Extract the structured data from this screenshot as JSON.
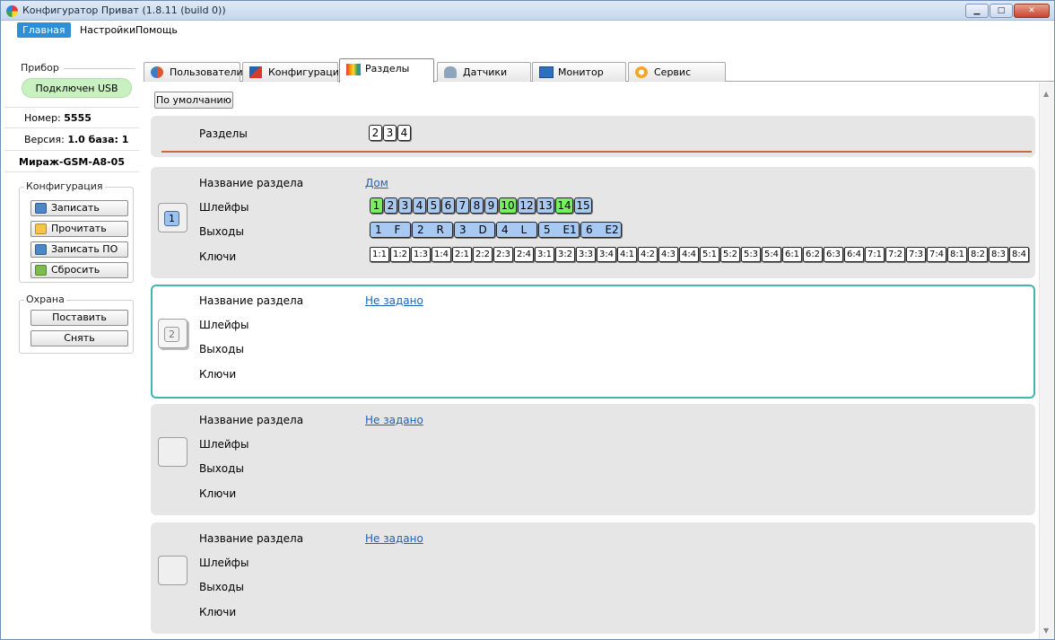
{
  "window": {
    "title": "Конфигуратор Приват (1.8.11 (build 0))"
  },
  "menu": {
    "items": [
      "Главная",
      "Настройки",
      "Помощь"
    ]
  },
  "device": {
    "legend": "Прибор",
    "status": "Подключен USB",
    "number_label": "Номер:",
    "number_value": "5555",
    "version_label": "Версия:",
    "version_value": "1.0 база: 1",
    "model": "Мираж-GSM-A8-05"
  },
  "config": {
    "legend": "Конфигурация",
    "write": "Записать",
    "read": "Прочитать",
    "write_fw": "Записать ПО",
    "reset": "Сбросить"
  },
  "guard": {
    "legend": "Охрана",
    "arm": "Поставить",
    "disarm": "Снять"
  },
  "tabs": [
    {
      "label": "Пользователи",
      "icon": "users-icon"
    },
    {
      "label": "Конфигурация",
      "icon": "tools-icon"
    },
    {
      "label": "Разделы",
      "icon": "sections-icon"
    },
    {
      "label": "Датчики",
      "icon": "sensors-icon"
    },
    {
      "label": "Монитор",
      "icon": "monitor-icon"
    },
    {
      "label": "Сервис",
      "icon": "service-icon"
    }
  ],
  "active_tab": "Разделы",
  "content": {
    "default_button": "По умолчанию",
    "sections_label": "Разделы",
    "sections_chips": [
      "2",
      "3",
      "4"
    ]
  },
  "labels": {
    "name": "Название раздела",
    "loops": "Шлейфы",
    "outputs": "Выходы",
    "keys": "Ключи"
  },
  "sections": [
    {
      "number": "1",
      "name": "Дом",
      "loops": [
        {
          "n": "1",
          "state": "green"
        },
        {
          "n": "2",
          "state": "blue"
        },
        {
          "n": "3",
          "state": "blue"
        },
        {
          "n": "4",
          "state": "blue"
        },
        {
          "n": "5",
          "state": "blue"
        },
        {
          "n": "6",
          "state": "blue"
        },
        {
          "n": "7",
          "state": "blue"
        },
        {
          "n": "8",
          "state": "blue"
        },
        {
          "n": "9",
          "state": "blue"
        },
        {
          "n": "10",
          "state": "green"
        },
        {
          "n": "12",
          "state": "blue"
        },
        {
          "n": "13",
          "state": "blue"
        },
        {
          "n": "14",
          "state": "green"
        },
        {
          "n": "15",
          "state": "blue"
        }
      ],
      "outputs": [
        "1 F",
        "2 R",
        "3 D",
        "4 L",
        "5 E1",
        "6 E2"
      ],
      "keys": [
        "1:1",
        "1:2",
        "1:3",
        "1:4",
        "2:1",
        "2:2",
        "2:3",
        "2:4",
        "3:1",
        "3:2",
        "3:3",
        "3:4",
        "4:1",
        "4:2",
        "4:3",
        "4:4",
        "5:1",
        "5:2",
        "5:3",
        "5:4",
        "6:1",
        "6:2",
        "6:3",
        "6:4",
        "7:1",
        "7:2",
        "7:3",
        "7:4",
        "8:1",
        "8:2",
        "8:3",
        "8:4"
      ]
    },
    {
      "number": "2",
      "name": "Не задано"
    },
    {
      "number": "",
      "name": "Не задано"
    },
    {
      "number": "",
      "name": "Не задано"
    }
  ],
  "colors": {
    "accent": "#2e8fd6",
    "selected_border": "#41b6aa",
    "chip_green": "#77f05e",
    "chip_blue": "#a7c9f2",
    "usb_green": "#c8f0c0"
  }
}
